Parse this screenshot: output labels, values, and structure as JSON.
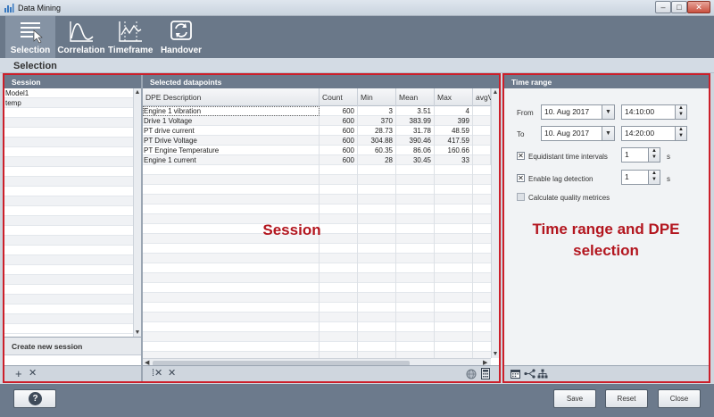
{
  "window": {
    "title": "Data Mining",
    "min_glyph": "–",
    "max_glyph": "□",
    "close_glyph": "✕"
  },
  "toolbar": {
    "items": [
      {
        "label": "Selection",
        "icon": "selection-icon",
        "active": true
      },
      {
        "label": "Correlation",
        "icon": "correlation-icon",
        "active": false
      },
      {
        "label": "Timeframe",
        "icon": "timeframe-icon",
        "active": false
      },
      {
        "label": "Handover",
        "icon": "handover-icon",
        "active": false
      }
    ]
  },
  "page_title": "Selection",
  "session": {
    "header": "Session",
    "items": [
      "Model1",
      "temp"
    ],
    "create_label": "Create new session",
    "add_glyph": "+",
    "delete_glyph": "✕"
  },
  "datapoints": {
    "header": "Selected datapoints",
    "columns": [
      "DPE Description",
      "Count",
      "Min",
      "Mean",
      "Max",
      "avgV"
    ],
    "rows": [
      [
        "Engine 1 vibration",
        "600",
        "3",
        "3.51",
        "4"
      ],
      [
        "Drive 1 Voltage",
        "600",
        "370",
        "383.99",
        "399"
      ],
      [
        "PT drive current",
        "600",
        "28.73",
        "31.78",
        "48.59"
      ],
      [
        "PT Drive Voltage",
        "600",
        "304.88",
        "390.46",
        "417.59"
      ],
      [
        "PT Engine Temperature",
        "600",
        "60.35",
        "86.06",
        "160.66"
      ],
      [
        "Engine 1 current",
        "600",
        "28",
        "30.45",
        "33"
      ]
    ],
    "footer_glyphs": {
      "select": "⁞✕",
      "remove": "✕"
    }
  },
  "time_range": {
    "header": "Time range",
    "from_label": "From",
    "from_date": "10. Aug 2017",
    "from_time": "14:10:00",
    "to_label": "To",
    "to_date": "10. Aug 2017",
    "to_time": "14:20:00",
    "equidistant": {
      "label": "Equidistant time intervals",
      "checked": true,
      "value": "1",
      "unit": "s"
    },
    "lag": {
      "label": "Enable lag detection",
      "checked": true,
      "value": "1",
      "unit": "s"
    },
    "quality": {
      "label": "Calculate quality metrices",
      "checked": false
    }
  },
  "annotations": {
    "session": "Session",
    "time_range_line1": "Time range and DPE",
    "time_range_line2": "selection"
  },
  "footer": {
    "help": "?",
    "save": "Save",
    "reset": "Reset",
    "close": "Close"
  },
  "colors": {
    "accent_red": "#cc1f2a",
    "toolbar": "#6a7889",
    "panel_header": "#6c7a8c"
  }
}
